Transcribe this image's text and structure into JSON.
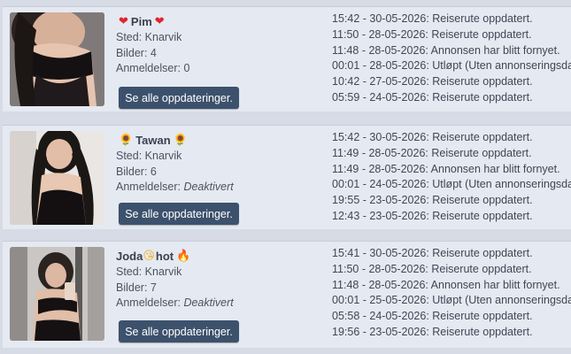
{
  "colors": {
    "page_bg": "#d6dbe5",
    "card_bg": "#e5e9f1",
    "button_bg": "#3c516c",
    "button_text": "#ffffff"
  },
  "listings": [
    {
      "name": "Pim",
      "name_emoji_left": "❤",
      "name_emoji_right": "❤",
      "name_emoji_left_icon": "red-heart-icon",
      "name_emoji_right_icon": "red-heart-icon",
      "place": "Sted: Knarvik",
      "pictures": "Bilder: 4",
      "reviews_label": "Anmeldelser: ",
      "reviews_value": "0",
      "button_label": "Se alle oppdateringer.",
      "updates": [
        "15:42 - 30-05-2026: Reiserute oppdatert.",
        "11:50 - 28-05-2026: Reiserute oppdatert.",
        "11:48 - 28-05-2026: Annonsen har blitt fornyet.",
        "00:01 - 28-05-2026: Utløpt (Uten annonseringsdag",
        "10:42 - 27-05-2026: Reiserute oppdatert.",
        "05:59 - 24-05-2026: Reiserute oppdatert."
      ]
    },
    {
      "name": "Tawan",
      "name_emoji_left": "🌻",
      "name_emoji_right": "🌻",
      "name_emoji_left_icon": "sunflower-icon",
      "name_emoji_right_icon": "sunflower-icon",
      "place": "Sted: Knarvik",
      "pictures": "Bilder: 6",
      "reviews_label": "Anmeldelser: ",
      "reviews_value": "Deaktivert",
      "button_label": "Se alle oppdateringer.",
      "updates": [
        "15:42 - 30-05-2026: Reiserute oppdatert.",
        "11:49 - 28-05-2026: Reiserute oppdatert.",
        "11:49 - 28-05-2026: Annonsen har blitt fornyet.",
        "00:01 - 24-05-2026: Utløpt (Uten annonseringsdag",
        "19:55 - 23-05-2026: Reiserute oppdatert.",
        "12:43 - 23-05-2026: Reiserute oppdatert."
      ]
    },
    {
      "name_part1": "Joda ",
      "name_part2": "hot",
      "name_emoji_mid": "😘",
      "name_emoji_right": "🔥",
      "name_emoji_mid_icon": "kissing-face-icon",
      "name_emoji_right_icon": "fire-icon",
      "place": "Sted: Knarvik",
      "pictures": "Bilder: 7",
      "reviews_label": "Anmeldelser: ",
      "reviews_value": "Deaktivert",
      "button_label": "Se alle oppdateringer.",
      "updates": [
        "15:41 - 30-05-2026: Reiserute oppdatert.",
        "11:50 - 28-05-2026: Reiserute oppdatert.",
        "11:48 - 28-05-2026: Annonsen har blitt fornyet.",
        "00:01 - 25-05-2026: Utløpt (Uten annonseringsdag",
        "05:58 - 24-05-2026: Reiserute oppdatert.",
        "19:56 - 23-05-2026: Reiserute oppdatert."
      ]
    }
  ]
}
